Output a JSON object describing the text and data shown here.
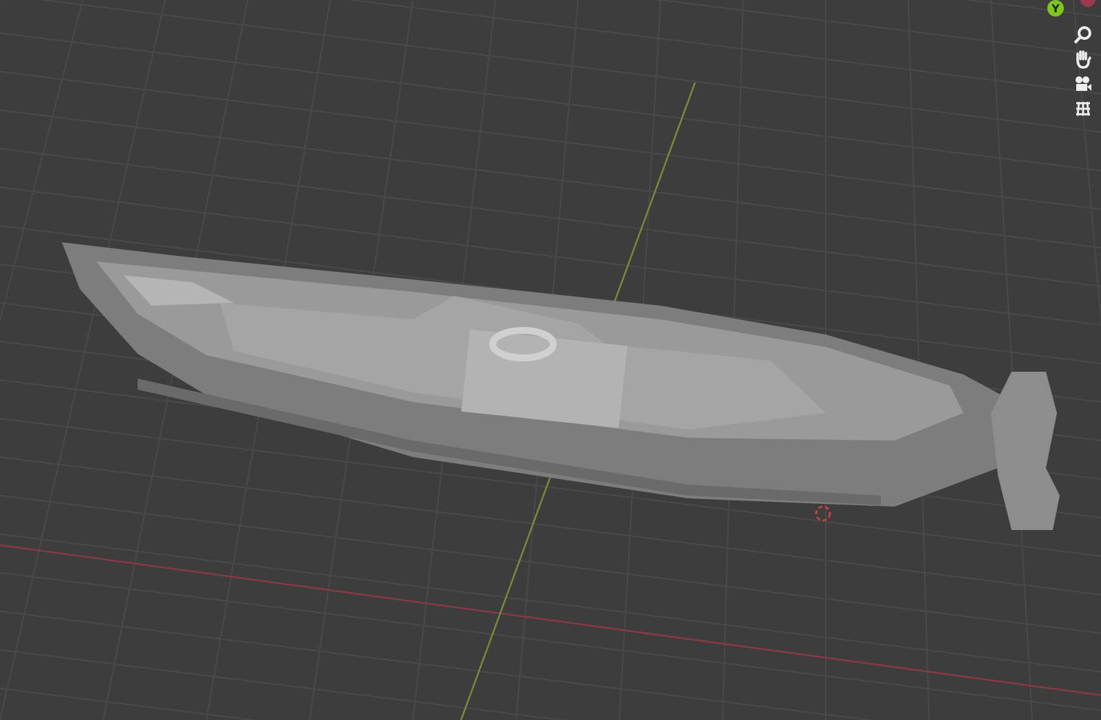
{
  "navigation_gizmo": {
    "axis_label": "Y"
  }
}
